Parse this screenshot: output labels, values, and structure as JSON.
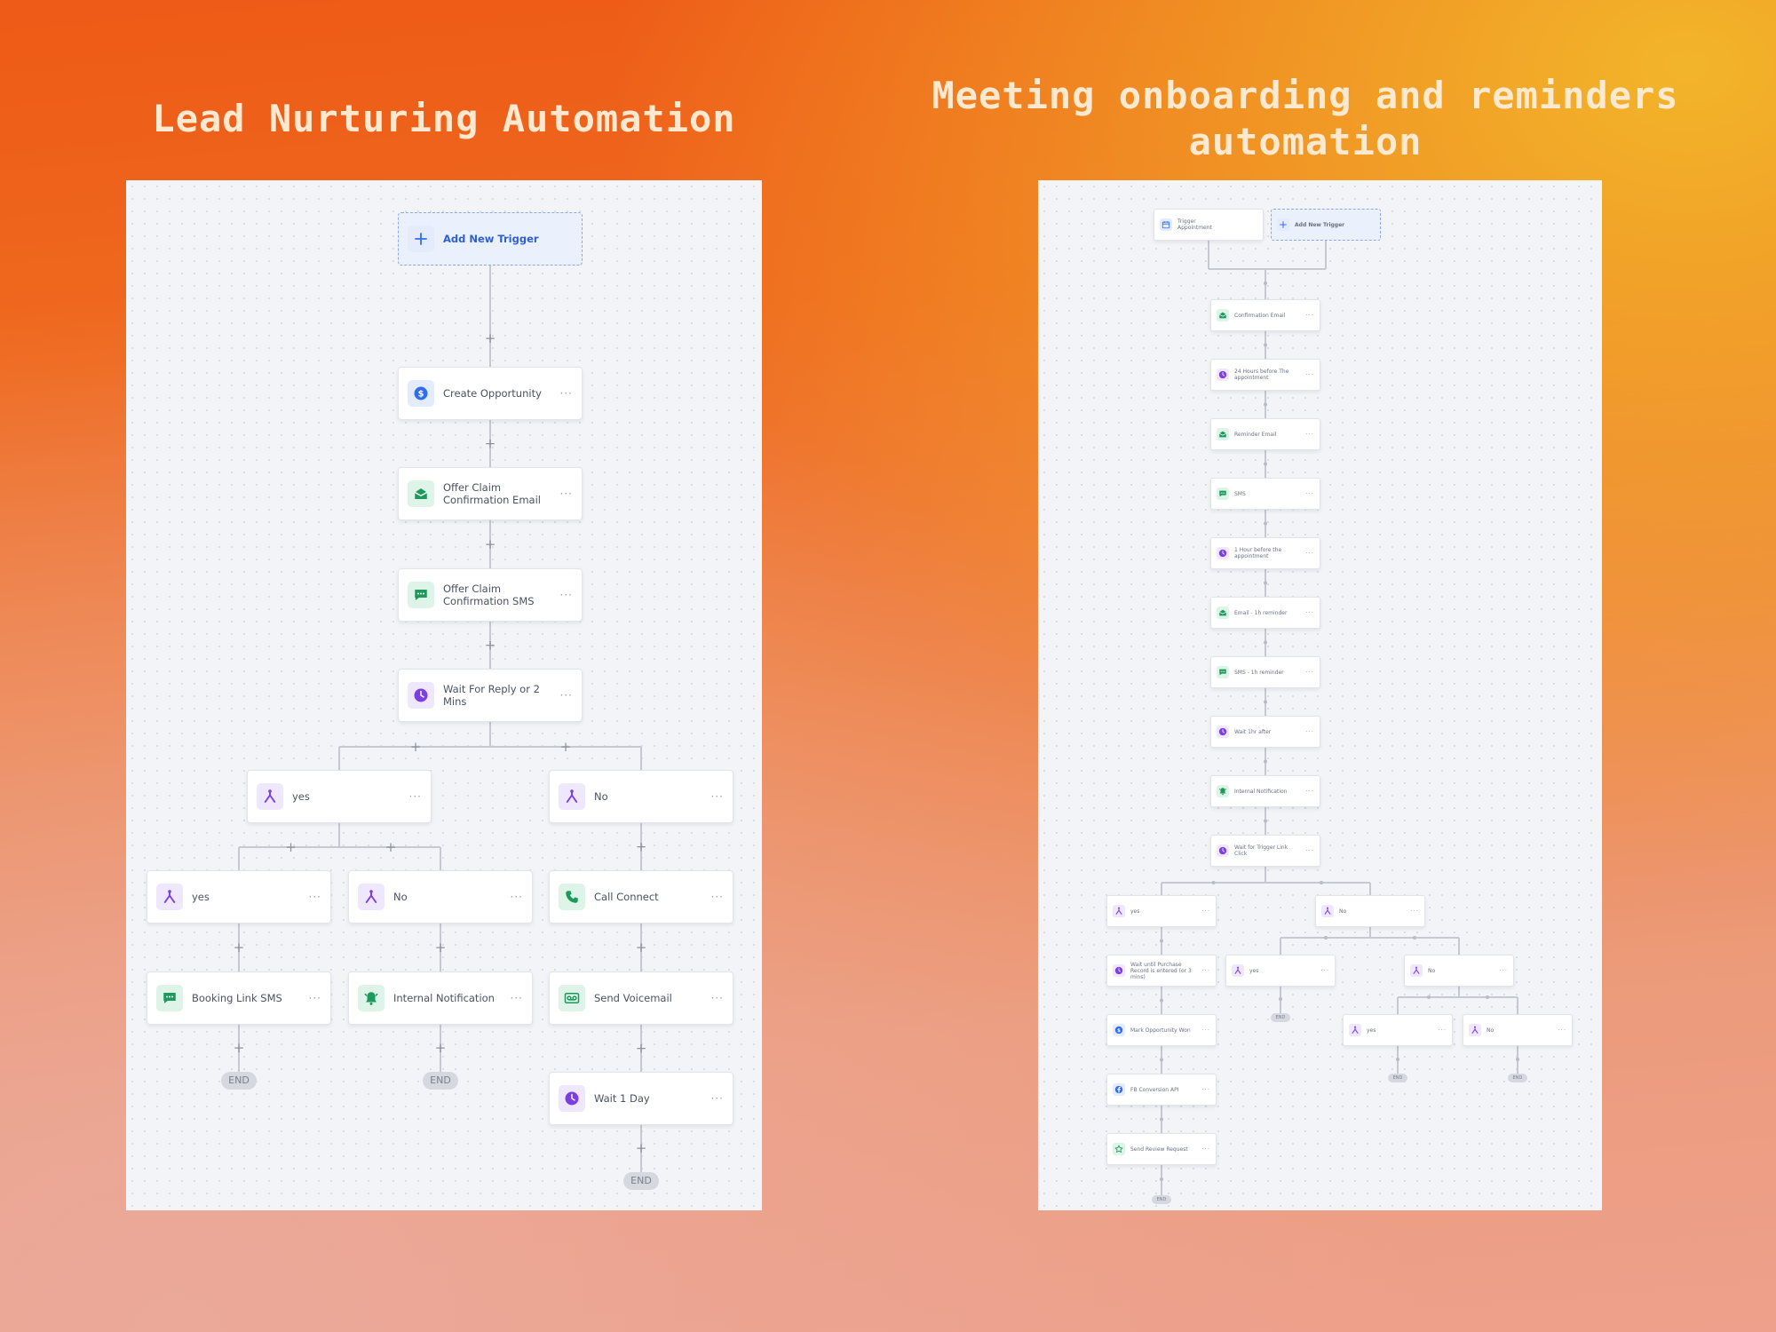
{
  "headings": {
    "left": "Lead Nurturing Automation",
    "right": "Meeting onboarding and reminders automation"
  },
  "left": {
    "trigger": "Add New Trigger",
    "nodes": [
      {
        "id": "create_opportunity",
        "label": "Create Opportunity",
        "icon": "dollar-icon",
        "color": "blue"
      },
      {
        "id": "offer_email",
        "label": "Offer Claim Confirmation Email",
        "icon": "email-icon",
        "color": "green"
      },
      {
        "id": "offer_sms",
        "label": "Offer Claim Confirmation SMS",
        "icon": "sms-icon",
        "color": "green"
      },
      {
        "id": "wait_reply",
        "label": "Wait For Reply or 2 Mins",
        "icon": "clock-icon",
        "color": "purple"
      },
      {
        "id": "yes_1",
        "label": "yes",
        "icon": "branch-icon",
        "color": "purple"
      },
      {
        "id": "no_1",
        "label": "No",
        "icon": "branch-icon",
        "color": "purple"
      },
      {
        "id": "yes_2",
        "label": "yes",
        "icon": "branch-icon",
        "color": "purple"
      },
      {
        "id": "no_2",
        "label": "No",
        "icon": "branch-icon",
        "color": "purple"
      },
      {
        "id": "call_connect",
        "label": "Call Connect",
        "icon": "phone-icon",
        "color": "green"
      },
      {
        "id": "booking_sms",
        "label": "Booking Link SMS",
        "icon": "sms-icon",
        "color": "green"
      },
      {
        "id": "internal_notification",
        "label": "Internal Notification",
        "icon": "bell-icon",
        "color": "green"
      },
      {
        "id": "send_voicemail",
        "label": "Send Voicemail",
        "icon": "voicemail-icon",
        "color": "green"
      },
      {
        "id": "wait_1_day",
        "label": "Wait 1 Day",
        "icon": "clock-icon",
        "color": "purple"
      }
    ],
    "end_label": "END",
    "plus": "+"
  },
  "right": {
    "trigger": {
      "title": "Trigger",
      "subtitle": "Appointment"
    },
    "add_trigger": "Add New Trigger",
    "nodes": [
      {
        "id": "confirmation_email",
        "label": "Confirmation Email",
        "icon": "email-icon",
        "color": "green"
      },
      {
        "id": "h24_before",
        "label": "24 Hours before The appointment",
        "icon": "clock-icon",
        "color": "purple"
      },
      {
        "id": "reminder_email",
        "label": "Reminder Email",
        "icon": "email-icon",
        "color": "green"
      },
      {
        "id": "sms",
        "label": "SMS",
        "icon": "sms-icon",
        "color": "green"
      },
      {
        "id": "h1_before",
        "label": "1 Hour before the appointment",
        "icon": "clock-icon",
        "color": "purple"
      },
      {
        "id": "email_reminder",
        "label": "Email - 1h reminder",
        "icon": "email-icon",
        "color": "green"
      },
      {
        "id": "sms_reminder",
        "label": "SMS - 1h reminder",
        "icon": "sms-icon",
        "color": "green"
      },
      {
        "id": "wait_after",
        "label": "Wait 1hr after",
        "icon": "clock-icon",
        "color": "purple"
      },
      {
        "id": "internal_notification",
        "label": "Internal Notification",
        "icon": "bell-icon",
        "color": "green"
      },
      {
        "id": "wait_trigger_link",
        "label": "Wait for Trigger Link Click",
        "icon": "clock-icon",
        "color": "purple"
      },
      {
        "id": "yes_a",
        "label": "yes",
        "icon": "branch-icon",
        "color": "purple"
      },
      {
        "id": "no_a",
        "label": "No",
        "icon": "branch-icon",
        "color": "purple"
      },
      {
        "id": "wait_purchase",
        "label": "Wait until Purchase Record is entered (or 3 mins)",
        "icon": "clock-icon",
        "color": "purple"
      },
      {
        "id": "yes_b",
        "label": "yes",
        "icon": "branch-icon",
        "color": "purple"
      },
      {
        "id": "no_b",
        "label": "No",
        "icon": "branch-icon",
        "color": "purple"
      },
      {
        "id": "mark_won",
        "label": "Mark Opportunity Won",
        "icon": "dollar-icon",
        "color": "blue"
      },
      {
        "id": "yes_c",
        "label": "yes",
        "icon": "branch-icon",
        "color": "purple"
      },
      {
        "id": "no_c",
        "label": "No",
        "icon": "branch-icon",
        "color": "purple"
      },
      {
        "id": "fb_conversion",
        "label": "FB Conversion API",
        "icon": "facebook-icon",
        "color": "blue"
      },
      {
        "id": "review_request",
        "label": "Send Review Request",
        "icon": "star-icon",
        "color": "green"
      }
    ],
    "end_label": "END"
  }
}
